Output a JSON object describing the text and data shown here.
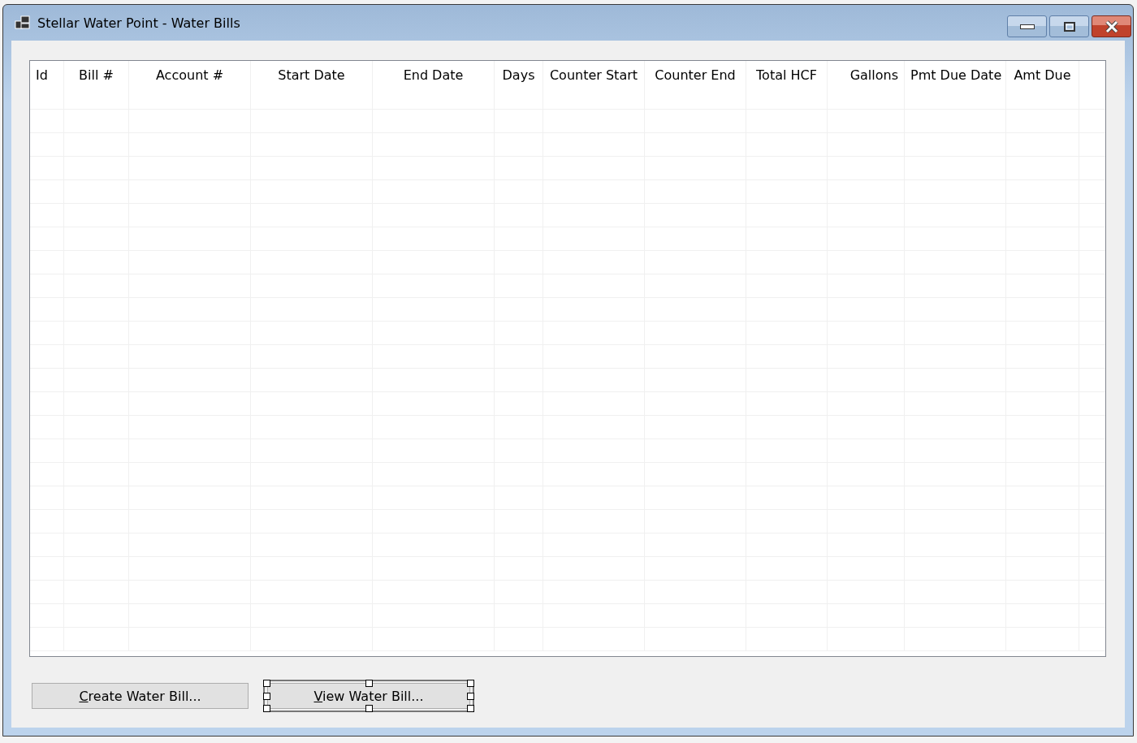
{
  "window": {
    "title": "Stellar Water Point - Water Bills"
  },
  "table": {
    "columns": [
      {
        "label": "Id"
      },
      {
        "label": "Bill #"
      },
      {
        "label": "Account #"
      },
      {
        "label": "Start Date"
      },
      {
        "label": "End Date"
      },
      {
        "label": "Days"
      },
      {
        "label": "Counter Start"
      },
      {
        "label": "Counter End"
      },
      {
        "label": "Total HCF"
      },
      {
        "label": "Gallons"
      },
      {
        "label": "Pmt Due Date"
      },
      {
        "label": "Amt Due"
      }
    ]
  },
  "buttons": [
    {
      "label": "Create Water Bill...",
      "selected": false
    },
    {
      "label": "View Water Bill...",
      "selected": true
    }
  ]
}
